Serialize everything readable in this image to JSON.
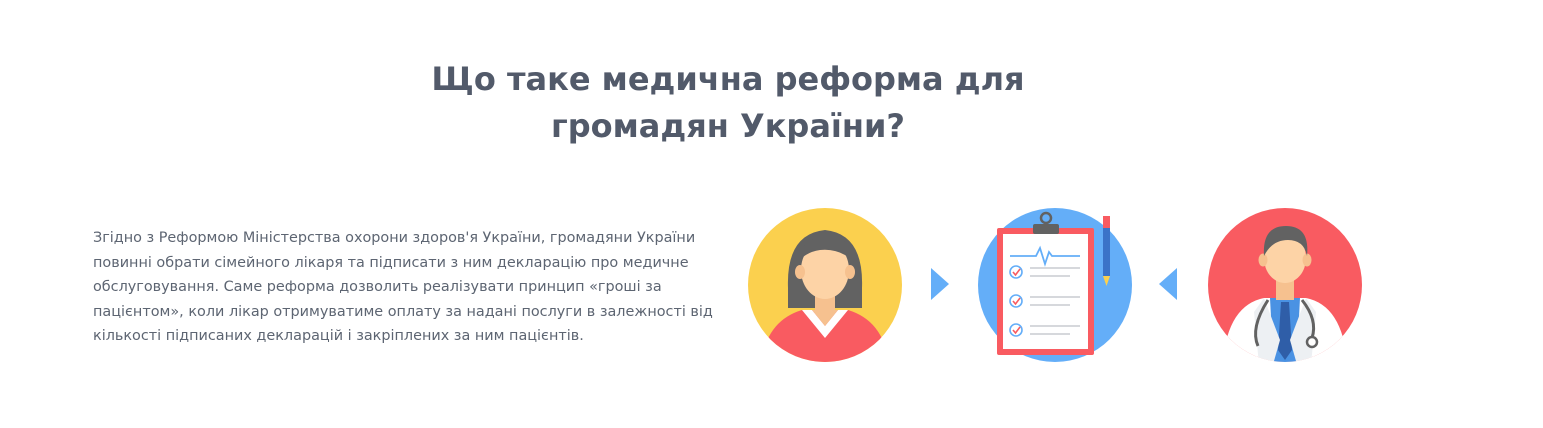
{
  "section": {
    "title_line1": "Що таке медична реформа для",
    "title_line2": "громадян України?",
    "description": "Згідно з Реформою Міністерства охорони здоров'я України, громадяни України повинні обрати сімейного лікаря та підписати з ним декларацію про медичне обслуговування. Саме реформа дозволить реалізувати принцип «гроші за пацієнтом», коли лікар отримуватиме оплату за надані послуги в залежності від кількості підписаних декларацій і закріплених за ним пацієнтів."
  },
  "colors": {
    "heading": "#525a6a",
    "text": "#5d6572",
    "patient_circle": "#fbd04e",
    "document_circle": "#64aef8",
    "doctor_circle": "#f95b61",
    "arrow": "#64aef8"
  },
  "icons": {
    "patient": "woman-patient-icon",
    "document": "clipboard-declaration-icon",
    "doctor": "doctor-icon",
    "arrow_right": "arrow-right-icon",
    "arrow_left": "arrow-left-icon"
  }
}
